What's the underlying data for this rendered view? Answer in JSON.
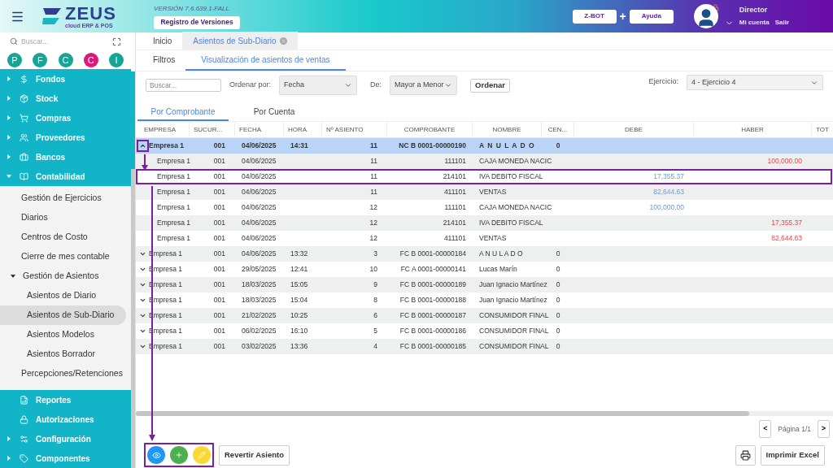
{
  "header": {
    "logo_name": "ZEUS",
    "logo_tagline": "cloud ERP & POS",
    "version": "VERSIÓN 7.6.639.1-FALL",
    "versions_button": "Registro de Versiones",
    "zbot_button": "Z-BOT",
    "plus": "+",
    "help_button": "Ayuda",
    "user": {
      "name": "Director",
      "account_link": "Mi cuenta",
      "logout_link": "Salir"
    }
  },
  "sidebar": {
    "search": {
      "placeholder": "Buscar..."
    },
    "shortcuts": [
      {
        "label": "P",
        "color": "#14a596"
      },
      {
        "label": "F",
        "color": "#14a596"
      },
      {
        "label": "C",
        "color": "#14a596"
      },
      {
        "label": "C",
        "color": "#e0177a"
      },
      {
        "label": "I",
        "color": "#14a596"
      }
    ],
    "items": [
      {
        "label": "Fondos",
        "expanded": false
      },
      {
        "label": "Stock",
        "expanded": false
      },
      {
        "label": "Compras",
        "expanded": false
      },
      {
        "label": "Proveedores",
        "expanded": false
      },
      {
        "label": "Bancos",
        "expanded": false
      },
      {
        "label": "Contabilidad",
        "expanded": true,
        "children": [
          {
            "label": "Gestión de Ejercicios",
            "selected": false
          },
          {
            "label": "Diarios",
            "selected": false
          },
          {
            "label": "Centros de Costo",
            "selected": false
          },
          {
            "label": "Cierre de mes contable",
            "selected": false
          },
          {
            "label": "Gestión de Asientos",
            "selected": false,
            "expanded": true,
            "children": [
              {
                "label": "Asientos de Diario",
                "selected": false
              },
              {
                "label": "Asientos de Sub-Diario",
                "selected": true
              },
              {
                "label": "Asientos Modelos",
                "selected": false
              },
              {
                "label": "Asientos Borrador",
                "selected": false
              }
            ]
          },
          {
            "label": "Percepciones/Retenciones",
            "selected": false
          }
        ]
      },
      {
        "label": "Reportes"
      },
      {
        "label": "Autorizaciones"
      },
      {
        "label": "Configuración",
        "expanded": false
      },
      {
        "label": "Componentes",
        "expanded": false
      }
    ]
  },
  "page_tabs": [
    {
      "label": "Inicio",
      "selected": false
    },
    {
      "label": "Asientos de Sub-Diario",
      "selected": true,
      "closable": true
    }
  ],
  "sub_tabs": [
    {
      "label": "Filtros",
      "selected": false
    },
    {
      "label": "Visualización de asientos de ventas",
      "selected": true
    }
  ],
  "filters": {
    "search": {
      "placeholder": "Buscar..."
    },
    "order_label": "Ordenar por:",
    "order_value": "Fecha",
    "direction_label": "De:",
    "direction_value": "Mayor a Menor",
    "order_button": "Ordenar",
    "period_label": "Ejercicio:",
    "period_value": "4 - Ejercicio 4"
  },
  "view_tabs": [
    {
      "label": "Por Comprobante",
      "selected": true
    },
    {
      "label": "Por Cuenta",
      "selected": false
    }
  ],
  "table": {
    "columns": [
      "EMPRESA",
      "SUCUR...",
      "FECHA",
      "HORA",
      "Nº ASIENTO",
      "COMPROBANTE",
      "NOMBRE",
      "CEN...",
      "DEBE",
      "HABER",
      "TOT"
    ],
    "rows": [
      {
        "kind": "group",
        "expanded": true,
        "selected": true,
        "highlighted": false,
        "toggle_highlighted": true,
        "cells": [
          "Empresa 1",
          "001",
          "04/06/2025",
          "14:31",
          "11",
          "NC B 0001-00000190",
          "A N U L A D O",
          "0"
        ]
      },
      {
        "kind": "detail",
        "selected": false,
        "highlighted": false,
        "cells": [
          "Empresa 1",
          "001",
          "04/06/2025",
          "",
          "11",
          "111101",
          "CAJA MONEDA NACIC",
          "",
          "",
          "100,000.00"
        ]
      },
      {
        "kind": "detail",
        "selected": false,
        "highlighted": true,
        "cells": [
          "Empresa 1",
          "001",
          "04/06/2025",
          "",
          "11",
          "214101",
          "IVA DEBITO FISCAL",
          "",
          "17,355.37",
          ""
        ]
      },
      {
        "kind": "detail",
        "selected": false,
        "highlighted": false,
        "cells": [
          "Empresa 1",
          "001",
          "04/06/2025",
          "",
          "11",
          "411101",
          "VENTAS",
          "",
          "82,644.63",
          ""
        ]
      },
      {
        "kind": "detail",
        "selected": false,
        "highlighted": false,
        "cells": [
          "Empresa 1",
          "001",
          "04/06/2025",
          "",
          "12",
          "111101",
          "CAJA MONEDA NACIC",
          "",
          "100,000.00",
          ""
        ]
      },
      {
        "kind": "detail",
        "selected": false,
        "highlighted": false,
        "cells": [
          "Empresa 1",
          "001",
          "04/06/2025",
          "",
          "12",
          "214101",
          "IVA DEBITO FISCAL",
          "",
          "",
          "17,355.37"
        ]
      },
      {
        "kind": "detail",
        "selected": false,
        "highlighted": false,
        "cells": [
          "Empresa 1",
          "001",
          "04/06/2025",
          "",
          "12",
          "411101",
          "VENTAS",
          "",
          "",
          "82,644.63"
        ]
      },
      {
        "kind": "group",
        "expanded": false,
        "selected": false,
        "highlighted": false,
        "toggle_highlighted": false,
        "cells": [
          "Empresa 1",
          "001",
          "04/06/2025",
          "13:32",
          "3",
          "FC B 0001-00000184",
          "A N U L A D O",
          "0"
        ]
      },
      {
        "kind": "group",
        "expanded": false,
        "selected": false,
        "highlighted": false,
        "toggle_highlighted": false,
        "cells": [
          "Empresa 1",
          "001",
          "29/05/2025",
          "12:41",
          "10",
          "FC A 0001-00000141",
          "Lucas Marín",
          "0"
        ]
      },
      {
        "kind": "group",
        "expanded": false,
        "selected": false,
        "highlighted": false,
        "toggle_highlighted": false,
        "cells": [
          "Empresa 1",
          "001",
          "18/03/2025",
          "15:05",
          "9",
          "FC B 0001-00000189",
          "Juan Ignacio Martínez",
          "0"
        ]
      },
      {
        "kind": "group",
        "expanded": false,
        "selected": false,
        "highlighted": false,
        "toggle_highlighted": false,
        "cells": [
          "Empresa 1",
          "001",
          "18/03/2025",
          "15:04",
          "8",
          "FC B 0001-00000188",
          "Juan Ignacio Martínez",
          "0"
        ]
      },
      {
        "kind": "group",
        "expanded": false,
        "selected": false,
        "highlighted": false,
        "toggle_highlighted": false,
        "cells": [
          "Empresa 1",
          "001",
          "21/02/2025",
          "10:25",
          "6",
          "FC B 0001-00000187",
          "CONSUMIDOR FINAL",
          "0"
        ]
      },
      {
        "kind": "group",
        "expanded": false,
        "selected": false,
        "highlighted": false,
        "toggle_highlighted": false,
        "cells": [
          "Empresa 1",
          "001",
          "06/02/2025",
          "16:10",
          "5",
          "FC B 0001-00000186",
          "CONSUMIDOR FINAL",
          "0"
        ]
      },
      {
        "kind": "group",
        "expanded": false,
        "selected": false,
        "highlighted": false,
        "toggle_highlighted": false,
        "cells": [
          "Empresa 1",
          "001",
          "03/02/2025",
          "13:36",
          "4",
          "FC B 0001-00000185",
          "CONSUMIDOR FINAL",
          "0"
        ]
      }
    ]
  },
  "pager": {
    "prev": "<",
    "label": "Página 1/1",
    "next": ">"
  },
  "actions": {
    "highlighted": true,
    "revert_button": "Revertir Asiento",
    "excel_button": "Imprimir Excel"
  }
}
